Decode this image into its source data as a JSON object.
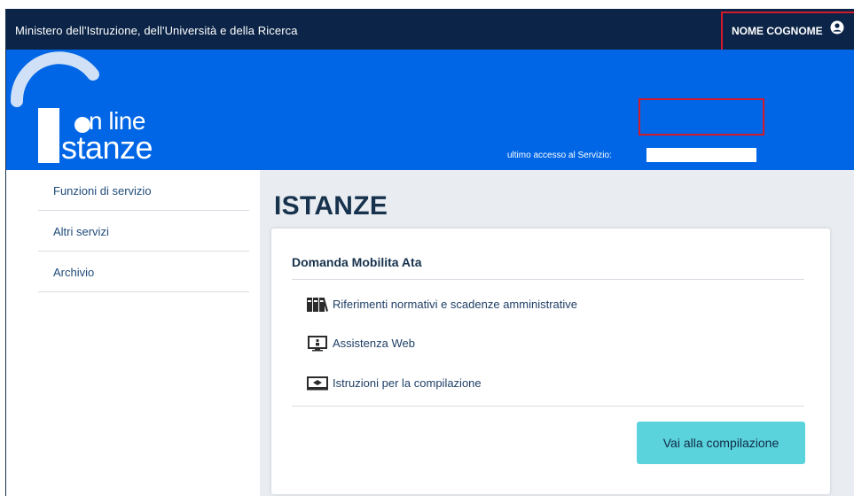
{
  "header": {
    "ministry": "Ministero dell'Istruzione, dell'Università e della Ricerca",
    "user_name": "NOME COGNOME",
    "user_icon": "user-circle-icon"
  },
  "banner": {
    "logo_online": "n line",
    "logo_stanze": "stanze",
    "last_access_label": "ultimo accesso al Servizio:",
    "last_access_value": ""
  },
  "sidebar": {
    "items": [
      {
        "label": "Funzioni di servizio"
      },
      {
        "label": "Altri servizi"
      },
      {
        "label": "Archivio"
      }
    ]
  },
  "main": {
    "title": "ISTANZE",
    "card": {
      "title": "Domanda Mobilita Ata",
      "links": [
        {
          "label": "Riferimenti normativi e scadenze amministrative",
          "icon": "books-icon"
        },
        {
          "label": "Assistenza Web",
          "icon": "web-assistance-icon"
        },
        {
          "label": "Istruzioni per la compilazione",
          "icon": "instructions-icon"
        }
      ],
      "cta_label": "Vai alla compilazione"
    }
  },
  "colors": {
    "topbar": "#0b2447",
    "banner": "#0066e6",
    "cta": "#5bd3dc",
    "highlight": "#d11a2a"
  }
}
